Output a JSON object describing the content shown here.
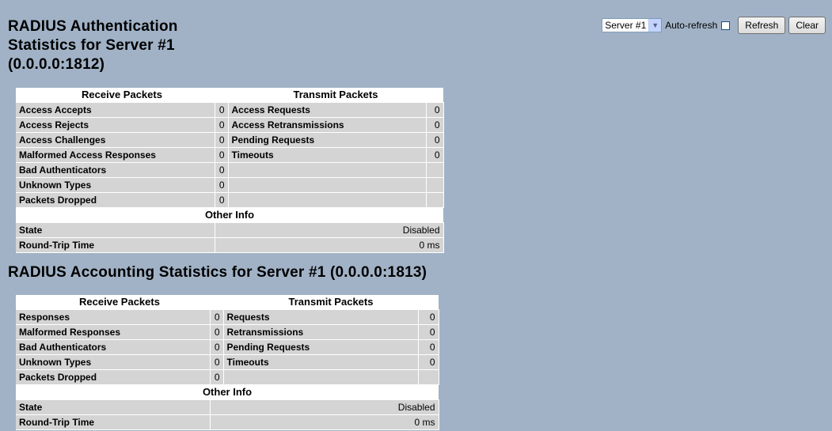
{
  "auth": {
    "title": "RADIUS Authentication Statistics for Server #1 (0.0.0.0:1812)",
    "receive_header": "Receive Packets",
    "transmit_header": "Transmit Packets",
    "other_header": "Other Info",
    "rows": [
      {
        "rx_label": "Access Accepts",
        "rx_value": "0",
        "tx_label": "Access Requests",
        "tx_value": "0"
      },
      {
        "rx_label": "Access Rejects",
        "rx_value": "0",
        "tx_label": "Access Retransmissions",
        "tx_value": "0"
      },
      {
        "rx_label": "Access Challenges",
        "rx_value": "0",
        "tx_label": "Pending Requests",
        "tx_value": "0"
      },
      {
        "rx_label": "Malformed Access Responses",
        "rx_value": "0",
        "tx_label": "Timeouts",
        "tx_value": "0"
      },
      {
        "rx_label": "Bad Authenticators",
        "rx_value": "0",
        "tx_label": "",
        "tx_value": ""
      },
      {
        "rx_label": "Unknown Types",
        "rx_value": "0",
        "tx_label": "",
        "tx_value": ""
      },
      {
        "rx_label": "Packets Dropped",
        "rx_value": "0",
        "tx_label": "",
        "tx_value": ""
      }
    ],
    "state_label": "State",
    "state_value": "Disabled",
    "rtt_label": "Round-Trip Time",
    "rtt_value": "0 ms"
  },
  "acct": {
    "title": "RADIUS Accounting Statistics for Server #1 (0.0.0.0:1813)",
    "receive_header": "Receive Packets",
    "transmit_header": "Transmit Packets",
    "other_header": "Other Info",
    "rows": [
      {
        "rx_label": "Responses",
        "rx_value": "0",
        "tx_label": "Requests",
        "tx_value": "0"
      },
      {
        "rx_label": "Malformed Responses",
        "rx_value": "0",
        "tx_label": "Retransmissions",
        "tx_value": "0"
      },
      {
        "rx_label": "Bad Authenticators",
        "rx_value": "0",
        "tx_label": "Pending Requests",
        "tx_value": "0"
      },
      {
        "rx_label": "Unknown Types",
        "rx_value": "0",
        "tx_label": "Timeouts",
        "tx_value": "0"
      },
      {
        "rx_label": "Packets Dropped",
        "rx_value": "0",
        "tx_label": "",
        "tx_value": ""
      }
    ],
    "state_label": "State",
    "state_value": "Disabled",
    "rtt_label": "Round-Trip Time",
    "rtt_value": "0 ms"
  },
  "controls": {
    "server_select": "Server #1",
    "autorefresh_label": "Auto-refresh",
    "refresh_label": "Refresh",
    "clear_label": "Clear"
  }
}
